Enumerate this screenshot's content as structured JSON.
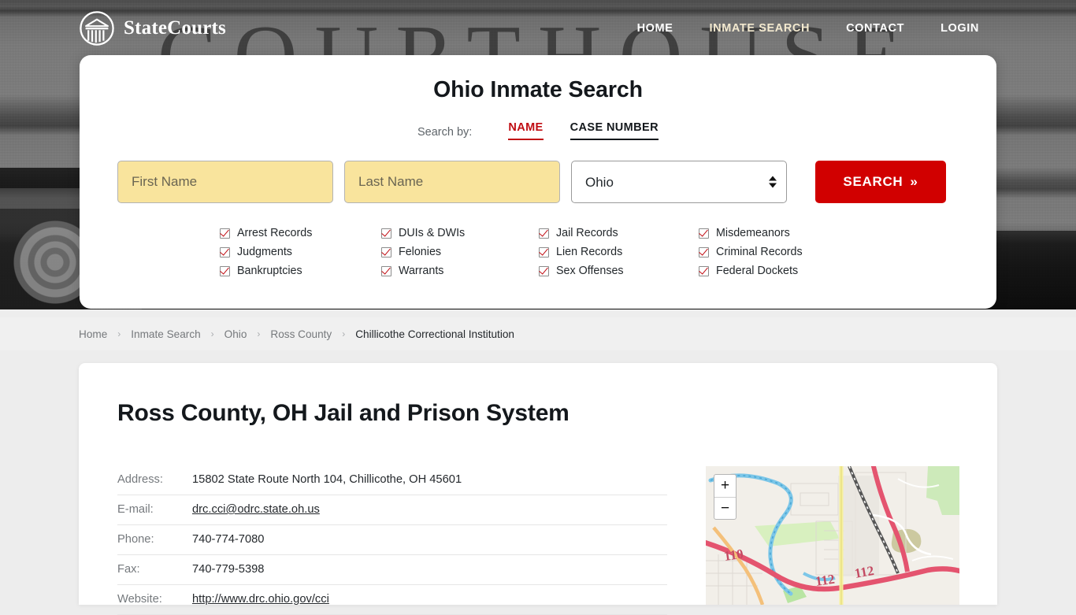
{
  "brand": {
    "name": "StateCourts",
    "logo_icon": "courthouse-circle-icon"
  },
  "nav": [
    {
      "label": "HOME",
      "active": false
    },
    {
      "label": "INMATE SEARCH",
      "active": true
    },
    {
      "label": "CONTACT",
      "active": false
    },
    {
      "label": "LOGIN",
      "active": false
    }
  ],
  "hero": {
    "watermark_text": "COURTHOUSE"
  },
  "search": {
    "title": "Ohio Inmate Search",
    "search_by_label": "Search by:",
    "tabs": [
      {
        "label": "NAME",
        "active": true,
        "color": "#c00c12"
      },
      {
        "label": "CASE NUMBER",
        "active": false,
        "color": "#14181c"
      }
    ],
    "first_name_placeholder": "First Name",
    "first_name_value": "",
    "last_name_placeholder": "Last Name",
    "last_name_value": "",
    "state_selected": "Ohio",
    "state_options": [
      "Ohio"
    ],
    "button_label": "SEARCH",
    "button_chevron": "»",
    "button_color": "#d10000",
    "input_color": "#f9e49d"
  },
  "features": [
    "Arrest Records",
    "DUIs & DWIs",
    "Jail Records",
    "Misdemeanors",
    "Judgments",
    "Felonies",
    "Lien Records",
    "Criminal Records",
    "Bankruptcies",
    "Warrants",
    "Sex Offenses",
    "Federal Dockets"
  ],
  "breadcrumb": {
    "separator": "›",
    "items": [
      {
        "label": "Home",
        "current": false
      },
      {
        "label": "Inmate Search",
        "current": false
      },
      {
        "label": "Ohio",
        "current": false
      },
      {
        "label": "Ross County",
        "current": false
      },
      {
        "label": "Chillicothe Correctional Institution",
        "current": true
      }
    ]
  },
  "facility": {
    "page_title": "Ross County, OH Jail and Prison System",
    "details": [
      {
        "key": "Address:",
        "value": "15802 State Route North 104, Chillicothe, OH 45601",
        "link": false
      },
      {
        "key": "E-mail:",
        "value": "drc.cci@odrc.state.oh.us",
        "link": true
      },
      {
        "key": "Phone:",
        "value": "740-774-7080",
        "link": false
      },
      {
        "key": "Fax:",
        "value": "740-779-5398",
        "link": false
      },
      {
        "key": "Website:",
        "value": "http://www.drc.ohio.gov/cci",
        "link": true
      }
    ]
  },
  "map": {
    "zoom_in_label": "+",
    "zoom_out_label": "−",
    "road_labels": [
      "110",
      "112",
      "112"
    ]
  }
}
